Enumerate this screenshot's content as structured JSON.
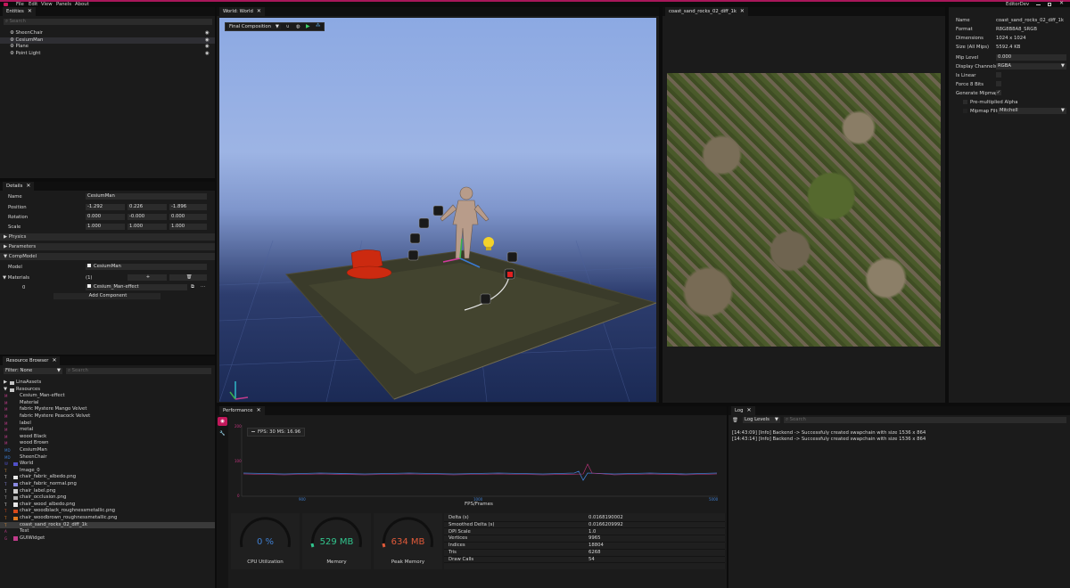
{
  "menubar": {
    "items": [
      "File",
      "Edit",
      "View",
      "Panels",
      "About"
    ],
    "title": "EditorDev"
  },
  "entities": {
    "tab": "Entities",
    "items": [
      "SheenChair",
      "CesiumMan",
      "Plane",
      "Point Light"
    ],
    "search_placeholder": "Search"
  },
  "details": {
    "tab": "Details",
    "name_label": "Name",
    "name_value": "CesiumMan",
    "position_label": "Position",
    "position": [
      "-1.292",
      "0.226",
      "-1.896"
    ],
    "rotation_label": "Rotation",
    "rotation": [
      "0.000",
      "-0.000",
      "0.000"
    ],
    "scale_label": "Scale",
    "scale": [
      "1.000",
      "1.000",
      "1.000"
    ],
    "sections": [
      "Physics",
      "Parameters",
      "CompModel"
    ],
    "model_label": "Model",
    "model_value": "CesiumMan",
    "materials_label": "Materials",
    "materials_count": "(1)",
    "material_index": "0",
    "material_value": "Cesium_Man-effect",
    "add_component": "Add Component"
  },
  "resources": {
    "tab": "Resource Browser",
    "filter": "Filter: None",
    "search_placeholder": "Search",
    "items": [
      {
        "label": "LinaAssets",
        "type": "",
        "icon": "folder",
        "color": "#c7c7c7"
      },
      {
        "label": "Resources",
        "type": "",
        "icon": "folder",
        "color": "#c7c7c7"
      },
      {
        "label": "Cesium_Man-effect",
        "type": "M",
        "icon": "",
        "color": "#c23c8c"
      },
      {
        "label": "Material",
        "type": "M",
        "icon": "",
        "color": "#c23c8c"
      },
      {
        "label": "fabric Mystere Mango Velvet",
        "type": "M",
        "icon": "",
        "color": "#c23c8c"
      },
      {
        "label": "fabric Mystere Peacock Velvet",
        "type": "M",
        "icon": "",
        "color": "#c23c8c"
      },
      {
        "label": "label",
        "type": "M",
        "icon": "",
        "color": "#c23c8c"
      },
      {
        "label": "metal",
        "type": "M",
        "icon": "",
        "color": "#c23c8c"
      },
      {
        "label": "wood Black",
        "type": "M",
        "icon": "",
        "color": "#c23c8c"
      },
      {
        "label": "wood Brown",
        "type": "M",
        "icon": "",
        "color": "#c23c8c"
      },
      {
        "label": "CesiumMan",
        "type": "MD",
        "icon": "",
        "color": "#3a7ad0"
      },
      {
        "label": "SheenChair",
        "type": "MD",
        "icon": "",
        "color": "#3a7ad0"
      },
      {
        "label": "World",
        "type": "W",
        "icon": "sq",
        "color": "#5050c8"
      },
      {
        "label": "Image_0",
        "type": "T",
        "icon": "",
        "color": "#d08b3a"
      },
      {
        "label": "chair_fabric_albedo.png",
        "type": "T",
        "icon": "sq",
        "color": "#e8e8e8"
      },
      {
        "label": "chair_fabric_normal.png",
        "type": "T",
        "icon": "sq",
        "color": "#8a8ae0"
      },
      {
        "label": "chair_label.png",
        "type": "T",
        "icon": "sq",
        "color": "#d0d0d0"
      },
      {
        "label": "chair_occlusion.png",
        "type": "T",
        "icon": "sq",
        "color": "#b0b0b0"
      },
      {
        "label": "chair_wood_albedo.png",
        "type": "T",
        "icon": "sq",
        "color": "#e8e8e8"
      },
      {
        "label": "chair_woodblack_roughnessmetallic.png",
        "type": "T",
        "icon": "sq",
        "color": "#d84a1a"
      },
      {
        "label": "chair_woodbrown_roughnessmetallic.png",
        "type": "T",
        "icon": "sq",
        "color": "#e07a20"
      },
      {
        "label": "coast_sand_rocks_02_diff_1k",
        "type": "T",
        "icon": "",
        "color": "#d08b3a"
      },
      {
        "label": "Test",
        "type": "A",
        "icon": "",
        "color": "#c23c8c"
      },
      {
        "label": "GUIWidget",
        "type": "G",
        "icon": "sq",
        "color": "#c23c8c"
      }
    ],
    "selected_index": 21
  },
  "world": {
    "tab": "World: World",
    "composition": "Final Composition"
  },
  "texture_tab": "coast_sand_rocks_02_diff_1k",
  "props": {
    "rows": [
      {
        "label": "Name",
        "value": "coast_sand_rocks_02_diff_1k"
      },
      {
        "label": "Format",
        "value": "R8G8B8A8_SRGB"
      },
      {
        "label": "Dimensions",
        "value": "1024 x 1024"
      },
      {
        "label": "Size (All Mips)",
        "value": "5592.4 KB"
      }
    ],
    "mip_label": "Mip Level",
    "mip_value": "0.000",
    "channels_label": "Display Channels",
    "channels_value": "RGBA",
    "linear_label": "Is Linear",
    "force8_label": "Force 8 Bits",
    "genmips_label": "Generate Mipmaps",
    "premult_label": "Pre-multiplied Alpha",
    "filter_label": "Mipmap Filter",
    "filter_value": "Mitchell"
  },
  "performance": {
    "tab": "Performance",
    "legend": "FPS: 30 MS: 16.96",
    "y_ticks": [
      "200",
      "100",
      "0"
    ],
    "x_ticks": [
      "900",
      "1000",
      "5000"
    ],
    "xlabel": "FPS/Frames",
    "cpu_value": "0 %",
    "cpu_label": "CPU Utilization",
    "cpu_fraction": 0.0,
    "mem_value": "529 MB",
    "mem_label": "Memory",
    "peak_value": "634 MB",
    "peak_label": "Peak Memory",
    "stats": [
      {
        "label": "Delta (s)",
        "value": "0.0168190002"
      },
      {
        "label": "Smoothed Delta (s)",
        "value": "0.0166209992"
      },
      {
        "label": "DPI Scale",
        "value": "1.0"
      },
      {
        "label": "Vertices",
        "value": "9965"
      },
      {
        "label": "Indices",
        "value": "18804"
      },
      {
        "label": "Tris",
        "value": "6268"
      },
      {
        "label": "Draw Calls",
        "value": "54"
      }
    ]
  },
  "log": {
    "tab": "Log",
    "levels": "Log Levels",
    "search_placeholder": "Search",
    "lines": [
      "[14:43:09] [Info] Backend -> Successfuly created swapchain with size 1536 x 864",
      "[14:43:14] [Info] Backend -> Successfuly created swapchain with size 1536 x 864"
    ]
  },
  "colors": {
    "accent": "#c2185b",
    "bg": "#1b1b1b",
    "input": "#2b2b2b",
    "plot_line": "#3f7fd1",
    "plot_line2": "#c2347e",
    "mem_good": "#31c48d",
    "mem_warn": "#e05a3a"
  }
}
